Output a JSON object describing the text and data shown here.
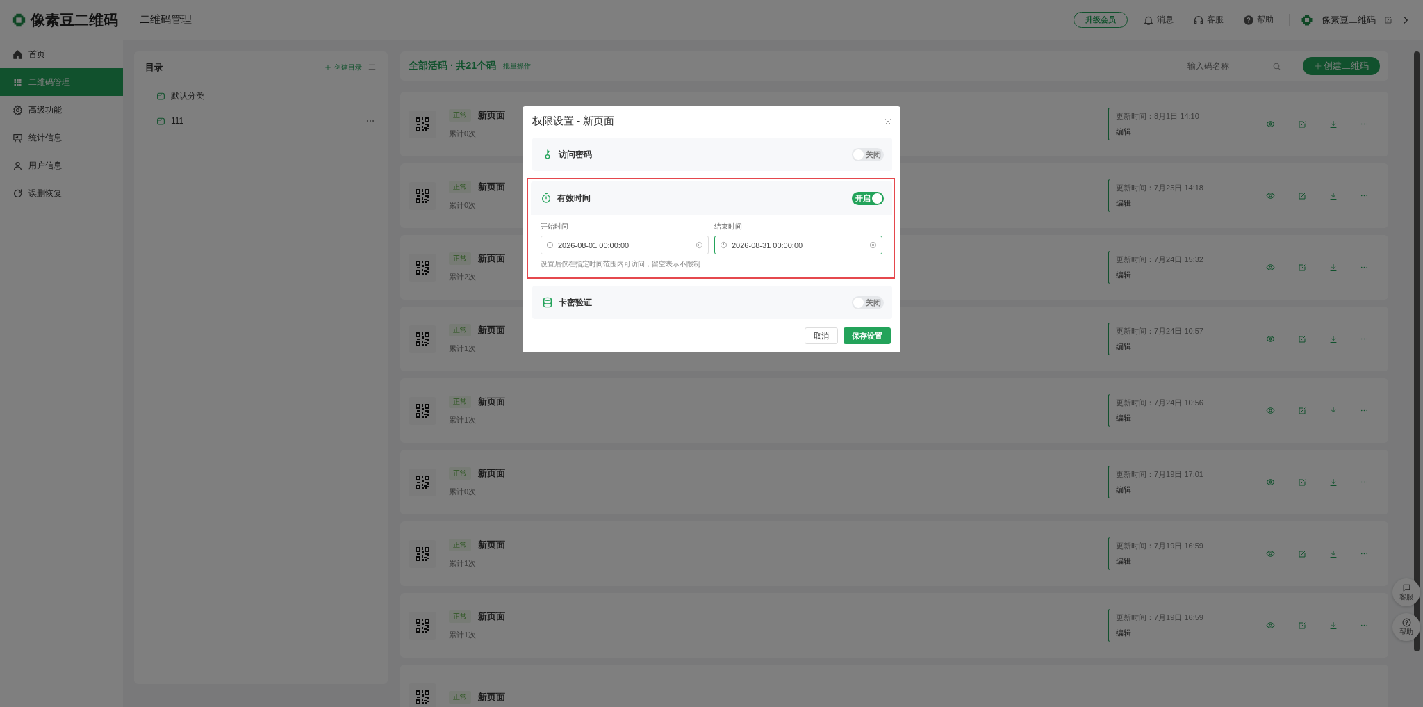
{
  "topbar": {
    "brand": "像素豆二维码",
    "page_title": "二维码管理",
    "upgrade": "升级会员",
    "links": [
      {
        "label": "消息"
      },
      {
        "label": "客服"
      },
      {
        "label": "帮助"
      }
    ],
    "account": "像素豆二维码"
  },
  "sidebar": {
    "items": [
      {
        "label": "首页",
        "selected": false
      },
      {
        "label": "二维码管理",
        "selected": true
      },
      {
        "label": "高级功能",
        "selected": false
      },
      {
        "label": "统计信息",
        "selected": false
      },
      {
        "label": "用户信息",
        "selected": false
      },
      {
        "label": "误删恢复",
        "selected": false
      }
    ]
  },
  "directory": {
    "title": "目录",
    "create": "创建目录",
    "folders": [
      {
        "name": "默认分类",
        "has_more": false
      },
      {
        "name": "111",
        "has_more": true
      }
    ]
  },
  "list": {
    "title": "全部活码 · 共21个码",
    "batch": "批量操作",
    "search_placeholder": "输入码名称",
    "create": "创建二维码",
    "rows": [
      {
        "status": "正常",
        "name": "新页面",
        "count": "累计0次",
        "updated": "更新时间：8月1日 14:10",
        "action": "编辑"
      },
      {
        "status": "正常",
        "name": "新页面",
        "count": "累计0次",
        "updated": "更新时间：7月25日 14:18",
        "action": "编辑"
      },
      {
        "status": "正常",
        "name": "新页面",
        "count": "累计2次",
        "updated": "更新时间：7月24日 15:32",
        "action": "编辑"
      },
      {
        "status": "正常",
        "name": "新页面",
        "count": "累计1次",
        "updated": "更新时间：7月24日 10:57",
        "action": "编辑"
      },
      {
        "status": "正常",
        "name": "新页面",
        "count": "累计1次",
        "updated": "更新时间：7月24日 10:56",
        "action": "编辑"
      },
      {
        "status": "正常",
        "name": "新页面",
        "count": "累计0次",
        "updated": "更新时间：7月19日 17:01",
        "action": "编辑"
      },
      {
        "status": "正常",
        "name": "新页面",
        "count": "累计1次",
        "updated": "更新时间：7月19日 16:59",
        "action": "编辑"
      },
      {
        "status": "正常",
        "name": "新页面",
        "count": "累计1次",
        "updated": "更新时间：7月19日 16:59",
        "action": "编辑"
      },
      {
        "status": "正常",
        "name": "新页面"
      }
    ]
  },
  "floating": [
    {
      "label": "客服"
    },
    {
      "label": "帮助"
    }
  ],
  "dialog": {
    "title": "权限设置 - 新页面",
    "sections": [
      {
        "title": "访问密码",
        "on": false,
        "switch_text": "关闭",
        "highlighted": false
      },
      {
        "title": "有效时间",
        "on": true,
        "switch_text": "开启",
        "highlighted": true,
        "fields": [
          {
            "label": "开始时间",
            "value": "2026-08-01 00:00:00",
            "focused": false
          },
          {
            "label": "结束时间",
            "value": "2026-08-31 00:00:00",
            "focused": true
          }
        ],
        "hint": "设置后仅在指定时间范围内可访问，留空表示不限制"
      },
      {
        "title": "卡密验证",
        "on": false,
        "switch_text": "关闭",
        "highlighted": false
      }
    ],
    "buttons": [
      {
        "label": "取消",
        "kind": "secondary"
      },
      {
        "label": "保存设置",
        "kind": "primary"
      }
    ]
  }
}
